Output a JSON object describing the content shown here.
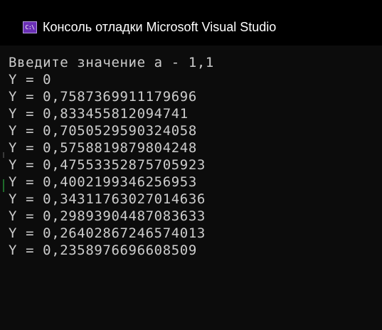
{
  "window": {
    "title": "Консоль отладки Microsoft Visual Studio",
    "icon": "console-app-icon",
    "icon_text": "C:\\",
    "accent_color": "#6a2fb5"
  },
  "console": {
    "lines": [
      "Введите значение a - 1,1",
      "Y = 0",
      "Y = 0,7587369911179696",
      "Y = 0,833455812094741",
      "Y = 0,7050529590324058",
      "Y = 0,5758819879804248",
      "Y = 0,47553352875705923",
      "Y = 0,4002199346256953",
      "Y = 0,34311763027014636",
      "Y = 0,29893904487083633",
      "Y = 0,2640286724657401З",
      "Y = 0,2358976696608509"
    ],
    "text_color": "#cccccc",
    "background_color": "#0c0c0c"
  }
}
